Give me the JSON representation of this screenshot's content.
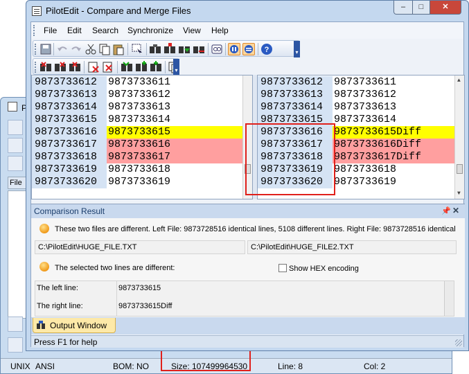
{
  "window": {
    "title": "PilotEdit - Compare and Merge Files"
  },
  "window_buttons": {
    "minimize": "–",
    "maximize": "□",
    "close": "✕"
  },
  "menu": [
    "File",
    "Edit",
    "Search",
    "Synchronize",
    "View",
    "Help"
  ],
  "left_pane": {
    "rows": [
      {
        "num": "9873733612",
        "text": "9873733611",
        "state": "normal"
      },
      {
        "num": "9873733613",
        "text": "9873733612",
        "state": "normal"
      },
      {
        "num": "9873733614",
        "text": "9873733613",
        "state": "normal"
      },
      {
        "num": "9873733615",
        "text": "9873733614",
        "state": "normal"
      },
      {
        "num": "9873733616",
        "text": "9873733615",
        "state": "yellow"
      },
      {
        "num": "9873733617",
        "text": "9873733616",
        "state": "pink"
      },
      {
        "num": "9873733618",
        "text": "9873733617",
        "state": "pink"
      },
      {
        "num": "9873733619",
        "text": "9873733618",
        "state": "normal"
      },
      {
        "num": "9873733620",
        "text": "9873733619",
        "state": "normal"
      }
    ]
  },
  "right_pane": {
    "rows": [
      {
        "num": "9873733612",
        "text": "9873733611",
        "state": "normal"
      },
      {
        "num": "9873733613",
        "text": "9873733612",
        "state": "normal"
      },
      {
        "num": "9873733614",
        "text": "9873733613",
        "state": "normal"
      },
      {
        "num": "9873733615",
        "text": "9873733614",
        "state": "normal"
      },
      {
        "num": "9873733616",
        "text": "9873733615Diff",
        "state": "yellow"
      },
      {
        "num": "9873733617",
        "text": "9873733616Diff",
        "state": "pink"
      },
      {
        "num": "9873733618",
        "text": "9873733617Diff",
        "state": "pink"
      },
      {
        "num": "9873733619",
        "text": "9873733618",
        "state": "normal"
      },
      {
        "num": "9873733620",
        "text": "9873733619",
        "state": "normal"
      }
    ]
  },
  "result": {
    "title": "Comparison Result",
    "message": "These two files are different. Left File: 9873728516 identical lines, 5108 different lines. Right File: 9873728516 identical",
    "left_file": "C:\\PilotEdit\\HUGE_FILE.TXT",
    "right_file": "C:\\PilotEdit\\HUGE_FILE2.TXT",
    "lines_message": "The selected two lines are different:",
    "show_hex_label": "Show HEX encoding",
    "left_line_label": "The left line:",
    "left_line_value": "9873733615",
    "right_line_label": "The right line:",
    "right_line_value": "9873733615Diff"
  },
  "output_tab": {
    "label": "Output Window"
  },
  "status": {
    "help": "Press F1 for help"
  },
  "background_window": {
    "title": "Pil",
    "file_label": "File",
    "status": {
      "encoding": "UNIX",
      "charset": "ANSI",
      "bom": "BOM: NO",
      "size": "Size: 107499964530",
      "line": "Line: 8",
      "col": "Col: 2"
    }
  },
  "colors": {
    "diff_current": "#ffff00",
    "diff_other": "#ff9f9f",
    "highlight_box": "#e0201b"
  }
}
